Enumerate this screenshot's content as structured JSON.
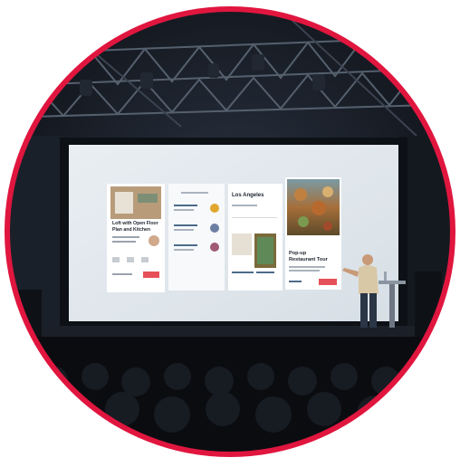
{
  "photo": {
    "frame_color": "#e0163f",
    "screen": {
      "card_1": {
        "title_line1": "Loft with Open Floor",
        "title_line2": "Plan and Kitchen"
      },
      "card_3": {
        "title": "Los Angeles"
      },
      "card_4": {
        "title_line1": "Pop-up",
        "title_line2": "Restaurant Tour"
      }
    }
  }
}
